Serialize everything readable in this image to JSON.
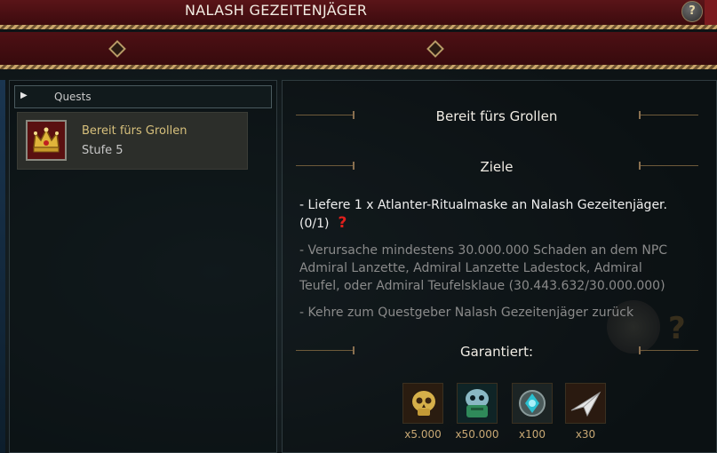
{
  "window": {
    "title": "NALASH GEZEITENJÄGER",
    "help_label": "?"
  },
  "quest_list": {
    "header": "Quests",
    "items": [
      {
        "name": "Bereit fürs Grollen",
        "level": "Stufe 5",
        "icon": "crown-icon"
      }
    ]
  },
  "detail": {
    "quest_title": "Bereit fürs Grollen",
    "objectives_heading": "Ziele",
    "objectives": [
      {
        "line1": "- Liefere 1 x Atlanter-Ritualmaske an Nalash Gezeitenjäger.",
        "line2": "(0/1)",
        "state": "active",
        "marker": "?"
      },
      {
        "line1": "- Verursache mindestens 30.000.000 Schaden an dem NPC",
        "line2": "Admiral Lanzette, Admiral Lanzette Ladestock, Admiral",
        "line3": "Teufel, oder Admiral Teufelsklaue (30.443.632/30.000.000)",
        "state": "done"
      },
      {
        "line1": "- Kehre zum Questgeber Nalash Gezeitenjäger zurück",
        "state": "done"
      }
    ],
    "rewards_heading": "Garantiert:",
    "rewards": [
      {
        "icon": "golden-skull-icon",
        "count": "x5.000"
      },
      {
        "icon": "green-mask-icon",
        "count": "x50.000"
      },
      {
        "icon": "cyan-gem-icon",
        "count": "x100"
      },
      {
        "icon": "paper-plane-icon",
        "count": "x30"
      }
    ]
  },
  "colors": {
    "title_bar": "#5a1418",
    "quest_name": "#d7c07c",
    "reward_count": "#c8a874",
    "missing_marker": "#e0201c",
    "active_text": "#f0f0f0",
    "done_text": "#8a8a8a"
  }
}
